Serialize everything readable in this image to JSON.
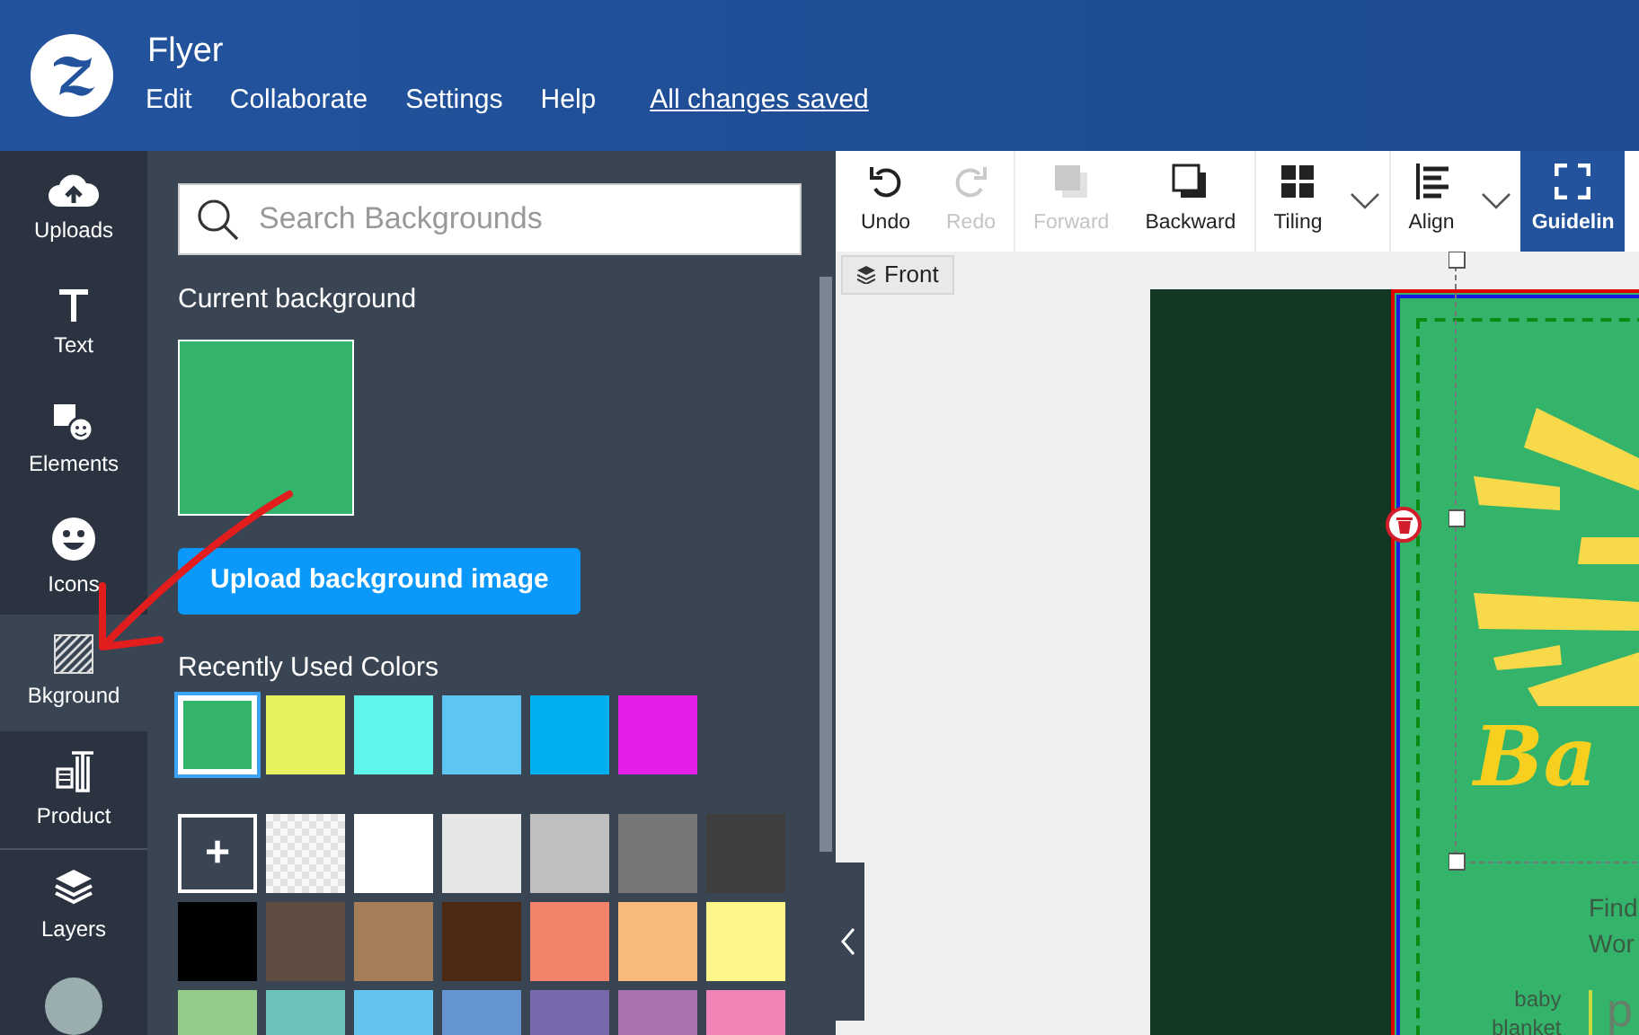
{
  "header": {
    "title": "Flyer",
    "menu": [
      {
        "label": "Edit"
      },
      {
        "label": "Collaborate"
      },
      {
        "label": "Settings"
      },
      {
        "label": "Help"
      }
    ],
    "save_status": "All changes saved"
  },
  "sidebar": {
    "items": [
      {
        "kind": "uploads",
        "label": "Uploads",
        "selected": false
      },
      {
        "kind": "text",
        "label": "Text",
        "selected": false
      },
      {
        "kind": "elements",
        "label": "Elements",
        "selected": false
      },
      {
        "kind": "icons",
        "label": "Icons",
        "selected": false
      },
      {
        "kind": "background",
        "label": "Bkground",
        "selected": true
      },
      {
        "kind": "product",
        "label": "Product",
        "selected": false
      },
      {
        "kind": "layers",
        "label": "Layers",
        "selected": false
      }
    ]
  },
  "panel": {
    "search": {
      "placeholder": "Search Backgrounds"
    },
    "current_heading": "Current background",
    "upload_button": "Upload background image",
    "recent_heading": "Recently Used Colors",
    "recent_colors": [
      {
        "color": "#34b36a",
        "selected": true
      },
      {
        "color": "#e8f25e",
        "selected": false
      },
      {
        "color": "#5ef5ec",
        "selected": false
      },
      {
        "color": "#5ec5f2",
        "selected": false
      },
      {
        "color": "#00b0ee",
        "selected": false
      },
      {
        "color": "#e51ee8",
        "selected": false
      }
    ],
    "add_label": "+",
    "palette": [
      {
        "kind": "transparent"
      },
      {
        "kind": "color",
        "color": "#ffffff"
      },
      {
        "kind": "color",
        "color": "#e6e6e6"
      },
      {
        "kind": "color",
        "color": "#bfbfbf"
      },
      {
        "kind": "color",
        "color": "#777777"
      },
      {
        "kind": "color",
        "color": "#3f3f3f"
      },
      {
        "kind": "color",
        "color": "#000000"
      },
      {
        "kind": "color",
        "color": "#5e4c40"
      },
      {
        "kind": "color",
        "color": "#a57d56"
      },
      {
        "kind": "color",
        "color": "#4e2a12"
      },
      {
        "kind": "color",
        "color": "#f3836b"
      },
      {
        "kind": "color",
        "color": "#f7ba78"
      },
      {
        "kind": "color",
        "color": "#fdf58a"
      },
      {
        "kind": "color",
        "color": "#93cc8b"
      },
      {
        "kind": "color",
        "color": "#6cc3bc"
      },
      {
        "kind": "color",
        "color": "#62c4ef"
      },
      {
        "kind": "color",
        "color": "#6594d3"
      },
      {
        "kind": "color",
        "color": "#7968ae"
      },
      {
        "kind": "color",
        "color": "#ab72b0"
      },
      {
        "kind": "color",
        "color": "#ef83b5"
      }
    ]
  },
  "toolbar": {
    "buttons": [
      {
        "kind": "undo",
        "label": "Undo",
        "disabled": false,
        "dropdown": false,
        "selected": false
      },
      {
        "kind": "redo",
        "label": "Redo",
        "disabled": true,
        "dropdown": false,
        "selected": false
      },
      {
        "kind": "forward",
        "label": "Forward",
        "disabled": true,
        "dropdown": false,
        "selected": false
      },
      {
        "kind": "backward",
        "label": "Backward",
        "disabled": false,
        "dropdown": false,
        "selected": false
      },
      {
        "kind": "tiling",
        "label": "Tiling",
        "disabled": false,
        "dropdown": true,
        "selected": false
      },
      {
        "kind": "align",
        "label": "Align",
        "disabled": false,
        "dropdown": true,
        "selected": false
      },
      {
        "kind": "guidelines",
        "label": "Guidelin",
        "disabled": false,
        "dropdown": false,
        "selected": true
      }
    ]
  },
  "canvas": {
    "side_button": "Front",
    "flyer": {
      "title": "Ba",
      "lines": [
        "Find",
        "Wor"
      ],
      "tag_lines": [
        "baby",
        "blanket"
      ],
      "tag_letter": "p"
    }
  }
}
